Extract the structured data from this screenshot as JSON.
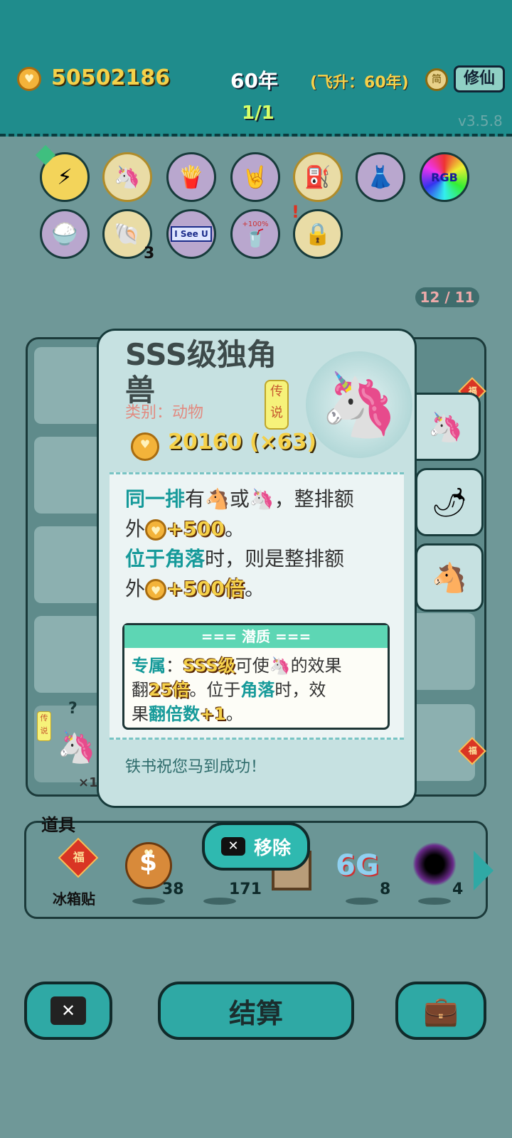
{
  "header": {
    "coins": "50502186",
    "year": "60年",
    "ascend": "(飞升：60年)",
    "simplified_label": "简",
    "xiuxian_button": "修仙",
    "round": "1/1",
    "version": "v3.5.8"
  },
  "icons_row1": [
    "lightning-icon",
    "unicorn-icon",
    "fries-icon",
    "rock-hand-icon",
    "pump-icon",
    "skirt-icon",
    "rgb-icon"
  ],
  "icons_row2": [
    "rice-bowl-icon",
    "shell-icon",
    "i-see-u-icon",
    "cup-icon",
    "safe-icon"
  ],
  "icon_texts": {
    "rgb": "RGB",
    "i_see_u": "I See U",
    "cup": "+100%",
    "shell_count": "3",
    "alert": "!"
  },
  "tally": "12 / 11",
  "popup": {
    "title": "SSS级独角兽",
    "category": "类别：动物",
    "rarity": "传说",
    "price": "20160 (×63)",
    "desc": {
      "line1_a": "同一排",
      "line1_b": "有",
      "line1_c": "或",
      "line1_d": "，整排额",
      "line2_a": "外",
      "line2_b": "+500",
      "line2_c": "。",
      "line3_a": "位于角落",
      "line3_b": "时，则是整排额",
      "line4_a": "外",
      "line4_b": "+500倍",
      "line4_c": "。"
    },
    "latent": {
      "header": "=== 潜质 ===",
      "l1_a": "专属",
      "l1_b": "：",
      "l1_c": "SSS级",
      "l1_d": "可使",
      "l1_e": "的效果",
      "l2_a": "翻",
      "l2_b": "25倍",
      "l2_c": "。位于",
      "l2_d": "角落",
      "l2_e": "时，效",
      "l3_a": "果",
      "l3_b": "翻倍数",
      "l3_c": "+1",
      "l3_d": "。"
    },
    "wish": "铁书祝您马到成功！"
  },
  "board": {
    "left_legend": "传说",
    "left_qty": "×1",
    "question": "?",
    "fu": "福"
  },
  "props": {
    "label": "道具",
    "items": [
      {
        "name": "冰箱贴",
        "qty": ""
      },
      {
        "name": "",
        "qty": "38"
      },
      {
        "name": "",
        "qty": "171"
      },
      {
        "name": "6G",
        "qty": "8"
      },
      {
        "name": "",
        "qty": "4"
      }
    ],
    "remove": "移除"
  },
  "bottom": {
    "settle": "结算"
  },
  "colors": {
    "teal": "#1f8c8c",
    "gold": "#f5d14a",
    "panel": "#c6e1e1"
  }
}
